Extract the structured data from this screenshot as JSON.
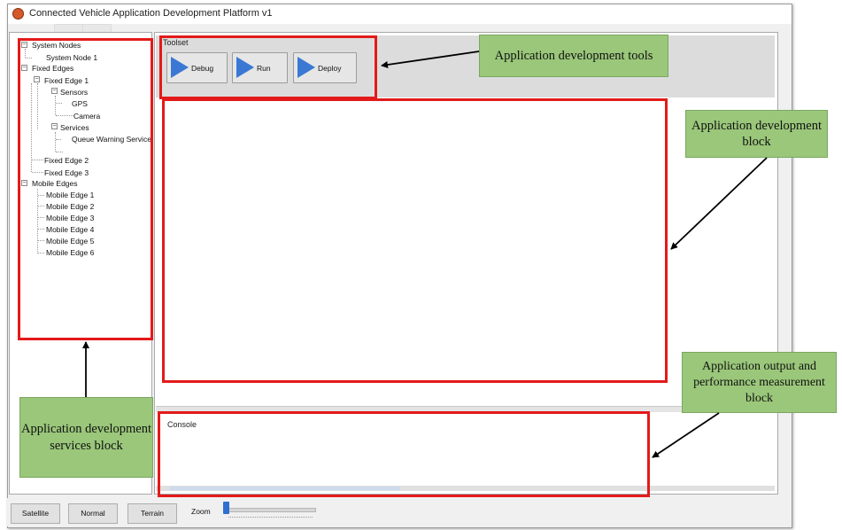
{
  "window": {
    "title": "Connected Vehicle Application Development Platform v1"
  },
  "tree": [
    {
      "label": "System Nodes"
    },
    {
      "label": "System Node 1"
    },
    {
      "label": "Fixed Edges"
    },
    {
      "label": "Fixed Edge 1"
    },
    {
      "label": "Sensors"
    },
    {
      "label": "GPS"
    },
    {
      "label": "Camera"
    },
    {
      "label": "Services"
    },
    {
      "label": "Queue Warning Service"
    },
    {
      "label": "Fixed Edge 2"
    },
    {
      "label": "Fixed Edge 3"
    },
    {
      "label": "Mobile Edges"
    },
    {
      "label": "Mobile Edge 1"
    },
    {
      "label": "Mobile Edge 2"
    },
    {
      "label": "Mobile Edge 3"
    },
    {
      "label": "Mobile Edge 4"
    },
    {
      "label": "Mobile Edge 5"
    },
    {
      "label": "Mobile Edge 6"
    }
  ],
  "toolset": {
    "label": "Toolset",
    "buttons": [
      {
        "label": "Debug",
        "icon": "play-icon"
      },
      {
        "label": "Run",
        "icon": "play-icon"
      },
      {
        "label": "Deploy",
        "icon": "play-icon"
      }
    ]
  },
  "console": {
    "label": "Console"
  },
  "bottom": {
    "buttons": [
      "Satellite",
      "Normal",
      "Terrain"
    ],
    "zoom_label": "Zoom"
  },
  "annotations": {
    "tools": "Application development tools",
    "dev_block": "Application development block",
    "output_block": "Application output and performance measurement block",
    "services_block": "Application development services block"
  },
  "colors": {
    "highlight": "#e31a1a",
    "callout": "#9ac77a",
    "accent": "#3a78d4"
  }
}
